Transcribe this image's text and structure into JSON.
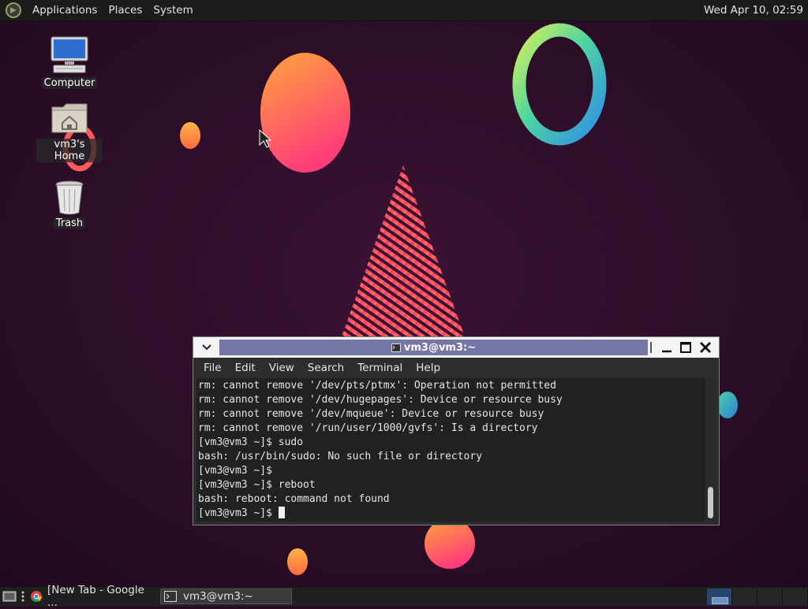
{
  "top_panel": {
    "menus": [
      "Applications",
      "Places",
      "System"
    ],
    "clock": "Wed Apr 10, 02:59"
  },
  "desktop": {
    "icons": [
      {
        "label": "Computer",
        "icon": "computer-icon"
      },
      {
        "label": "vm3's Home",
        "icon": "home-folder-icon"
      },
      {
        "label": "Trash",
        "icon": "trash-icon"
      }
    ]
  },
  "terminal": {
    "title": "vm3@vm3:~",
    "menus": [
      "File",
      "Edit",
      "View",
      "Search",
      "Terminal",
      "Help"
    ],
    "lines": [
      "rm: cannot remove '/dev/pts/ptmx': Operation not permitted",
      "rm: cannot remove '/dev/hugepages': Device or resource busy",
      "rm: cannot remove '/dev/mqueue': Device or resource busy",
      "rm: cannot remove '/run/user/1000/gvfs': Is a directory",
      "[vm3@vm3 ~]$ sudo",
      "bash: /usr/bin/sudo: No such file or directory",
      "[vm3@vm3 ~]$",
      "[vm3@vm3 ~]$ reboot",
      "bash: reboot: command not found"
    ],
    "prompt": "[vm3@vm3 ~]$ "
  },
  "taskbar": {
    "tasks": [
      {
        "label": "[New Tab - Google ...",
        "icon": "chrome-icon",
        "active": false
      },
      {
        "label": "vm3@vm3:~",
        "icon": "terminal-icon",
        "active": true
      }
    ],
    "workspaces": 4,
    "active_workspace": 1
  },
  "colors": {
    "wallpaper": "#2a0d25",
    "panel": "#1b1b1b",
    "title_highlight": "#7777a6",
    "terminal_bg": "#212121"
  }
}
